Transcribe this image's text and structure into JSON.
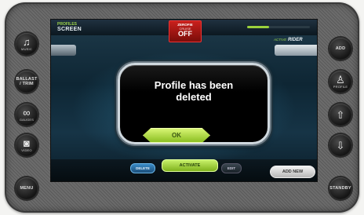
{
  "left_buttons": [
    {
      "id": "music",
      "label": "MUSIC",
      "icon": "music-note-icon"
    },
    {
      "id": "ballast",
      "label": "BALLAST / TRIM",
      "icon": ""
    },
    {
      "id": "gauges",
      "label": "GAUGES",
      "icon": "gauge-icon"
    },
    {
      "id": "video",
      "label": "VIDEO",
      "icon": "camera-icon"
    },
    {
      "id": "menu",
      "label": "MENU",
      "icon": ""
    }
  ],
  "right_buttons": [
    {
      "id": "add",
      "label": "ADD",
      "icon": ""
    },
    {
      "id": "profile",
      "label": "PROFILE",
      "icon": "rider-icon"
    },
    {
      "id": "up",
      "label": "",
      "icon": "arrow-up-icon"
    },
    {
      "id": "down",
      "label": "",
      "icon": "arrow-down-icon"
    },
    {
      "id": "standby",
      "label": "STANDBY",
      "icon": ""
    }
  ],
  "screen": {
    "section_label": "PROFILES",
    "title": "SCREEN",
    "zeromile": {
      "line1": "ZEROFIE",
      "line2": "CRUISE",
      "line3": "OFF"
    },
    "active_rider_prefix": "ACTIVE",
    "active_rider_label": "RIDER",
    "progress_fraction": 0.35
  },
  "dialog": {
    "message": "Profile has been deleted",
    "ok_label": "OK"
  },
  "bottom": {
    "delete_label": "DELETE",
    "activate_label": "ACTIVATE",
    "edit_label": "EDIT",
    "add_new_label": "ADD NEW"
  },
  "colors": {
    "accent_green": "#9bd23c",
    "delete_blue": "#2f78b0",
    "zeromile_red": "#c8201c"
  }
}
